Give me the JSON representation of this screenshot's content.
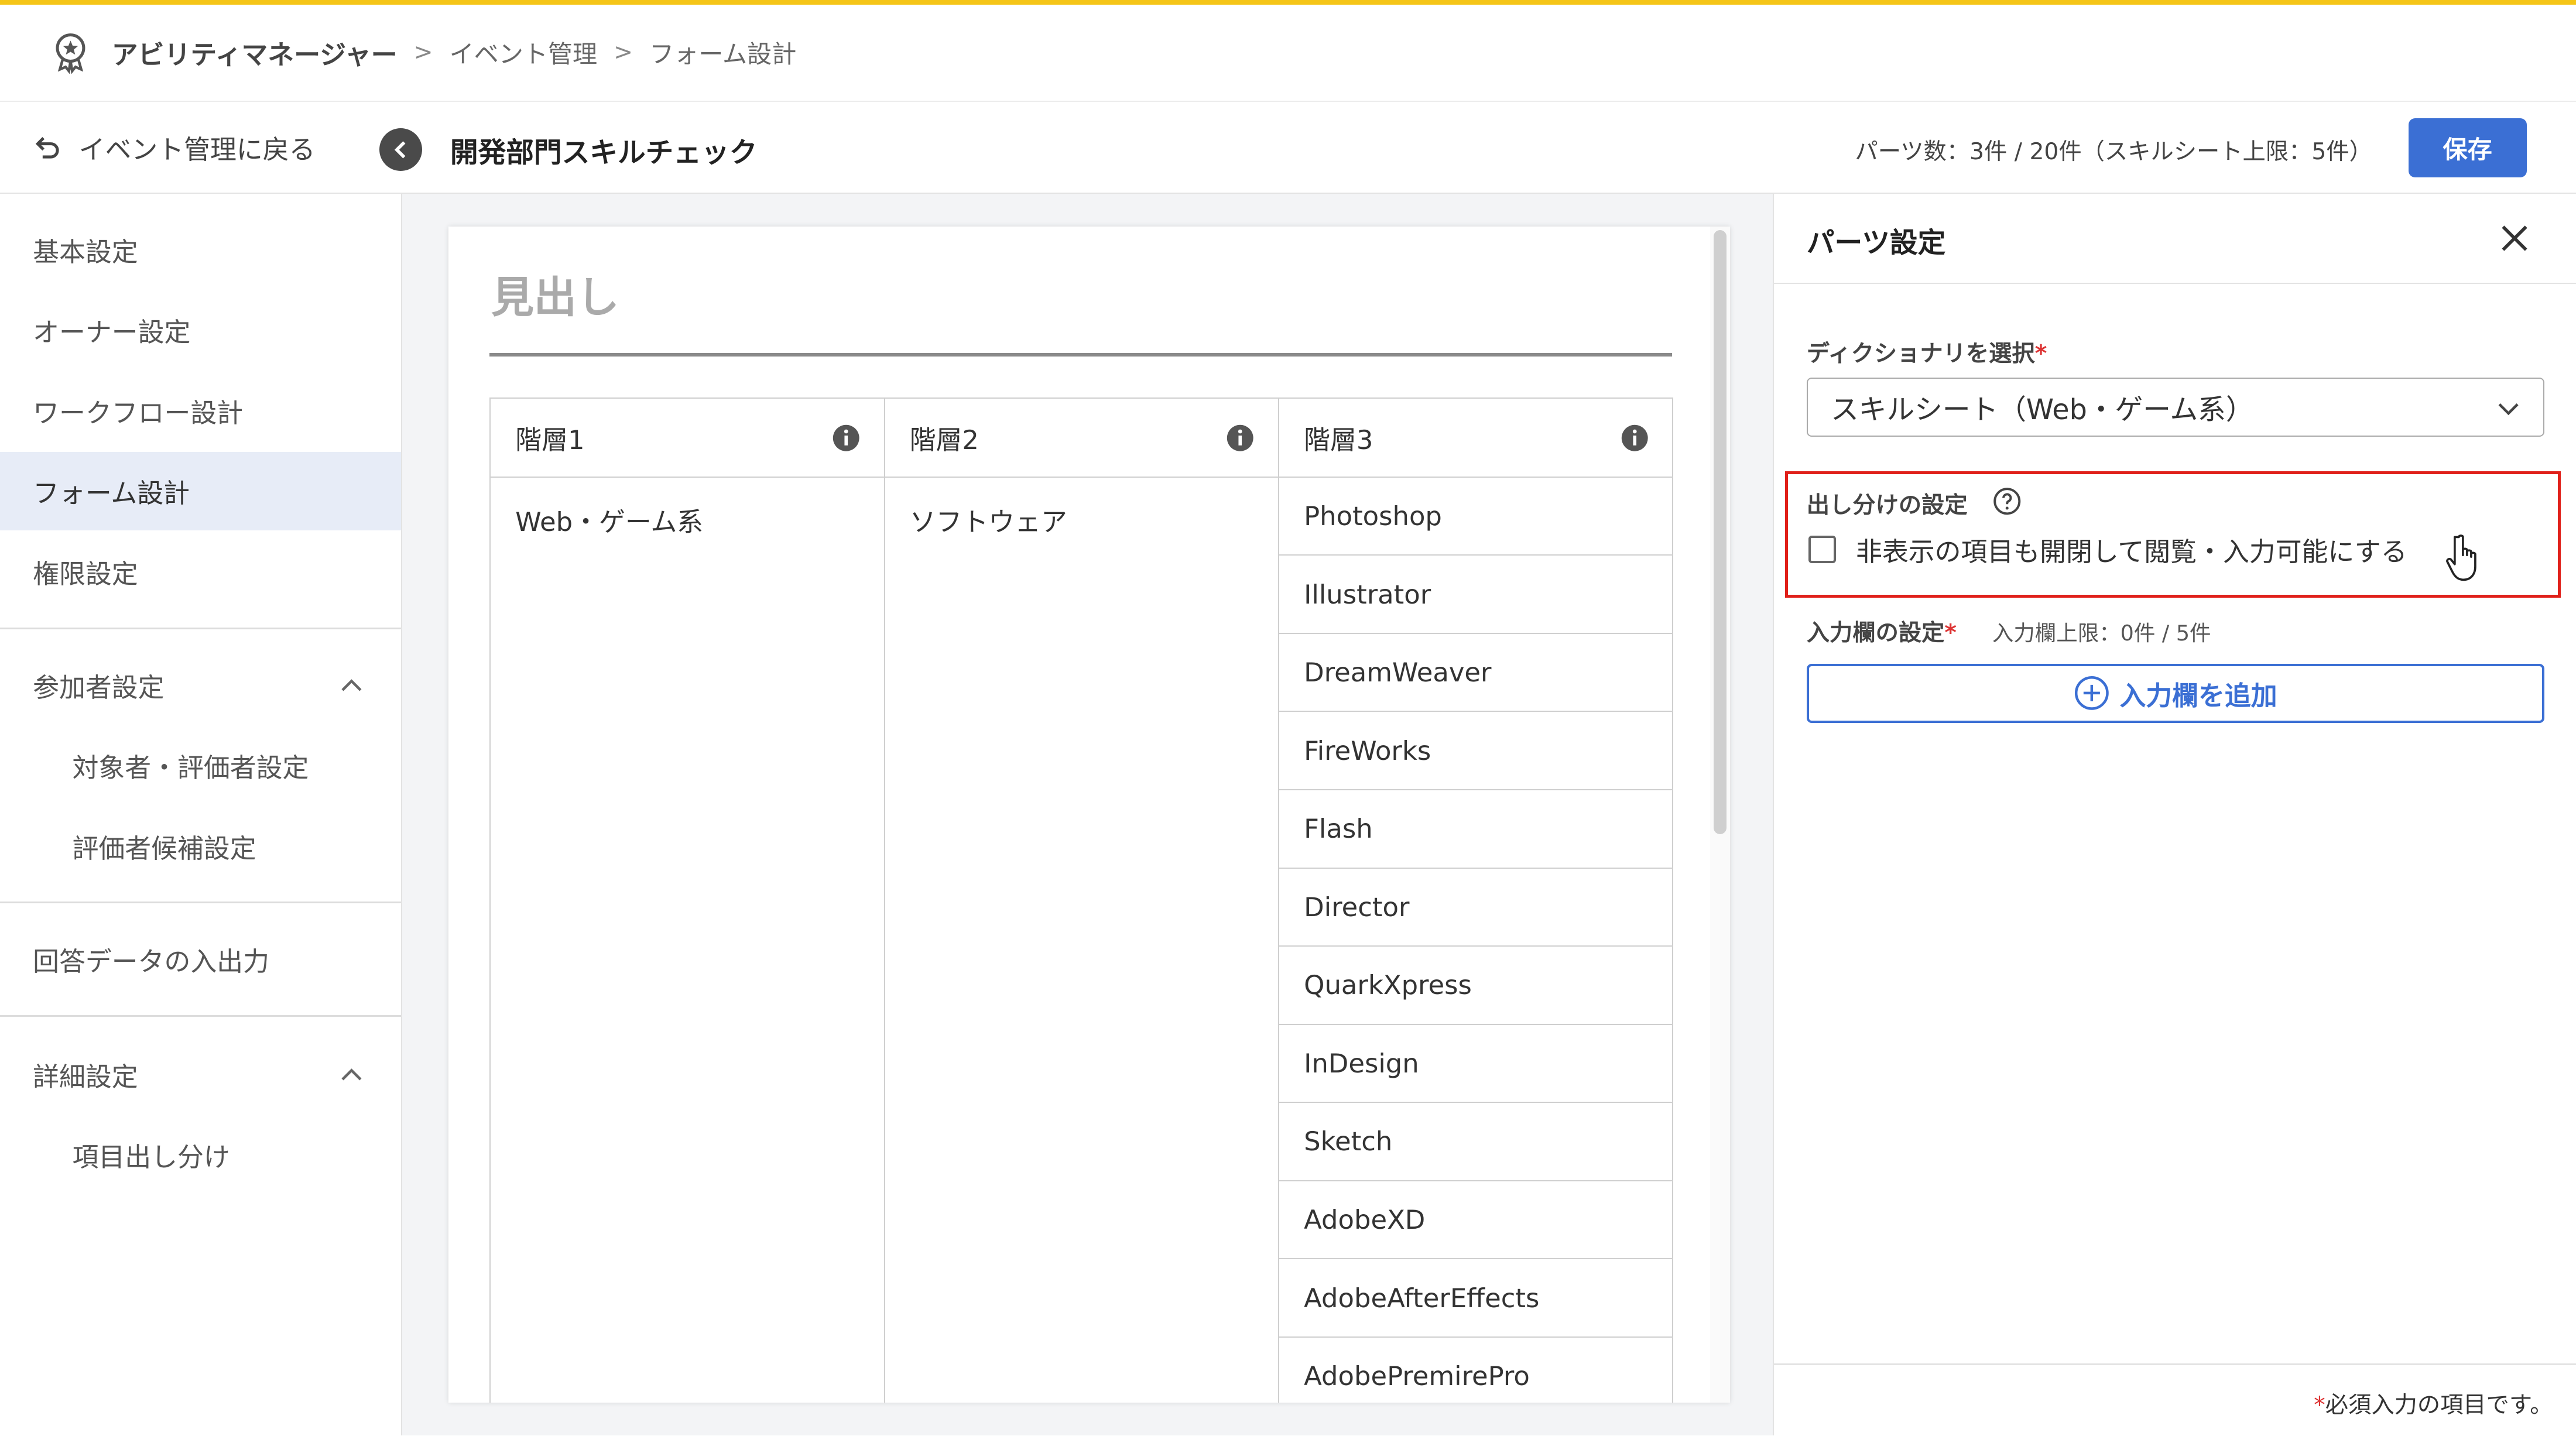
{
  "header": {
    "app_name": "アビリティマネージャー",
    "breadcrumb": [
      "イベント管理",
      "フォーム設計"
    ],
    "accent_color": "#f5c518"
  },
  "subheader": {
    "back_label": "イベント管理に戻る",
    "event_title": "開発部門スキルチェック",
    "parts_count": "パーツ数：3件 / 20件（スキルシート上限：5件）",
    "save_label": "保存",
    "save_color": "#3b6fd4"
  },
  "sidebar": {
    "items": [
      "基本設定",
      "オーナー設定",
      "ワークフロー設計",
      "フォーム設計",
      "権限設定"
    ],
    "active": "フォーム設計",
    "participants": {
      "label": "参加者設定",
      "children": [
        "対象者・評価者設定",
        "評価者候補設定"
      ]
    },
    "answer_io": "回答データの入出力",
    "advanced": {
      "label": "詳細設定",
      "children": [
        "項目出し分け"
      ]
    }
  },
  "form": {
    "heading": "見出し",
    "columns": [
      "階層1",
      "階層2",
      "階層3"
    ],
    "level1_value": "Web・ゲーム系",
    "level2_value": "ソフトウェア",
    "level3_values": [
      "Photoshop",
      "Illustrator",
      "DreamWeaver",
      "FireWorks",
      "Flash",
      "Director",
      "QuarkXpress",
      "InDesign",
      "Sketch",
      "AdobeXD",
      "AdobeAfterEffects",
      "AdobePremirePro"
    ]
  },
  "panel": {
    "title": "パーツ設定",
    "dictionary_label": "ディクショナリを選択",
    "dictionary_value": "スキルシート（Web・ゲーム系）",
    "visibility_label": "出し分けの設定",
    "visibility_checkbox_label": "非表示の項目も開閉して閲覧・入力可能にする",
    "visibility_checked": false,
    "input_label": "入力欄の設定",
    "input_limit": "入力欄上限：0件 / 5件",
    "add_input_label": "入力欄を追加",
    "required_note": "必須入力の項目です。",
    "required_mark": "*",
    "highlight_color": "#e0201a"
  }
}
